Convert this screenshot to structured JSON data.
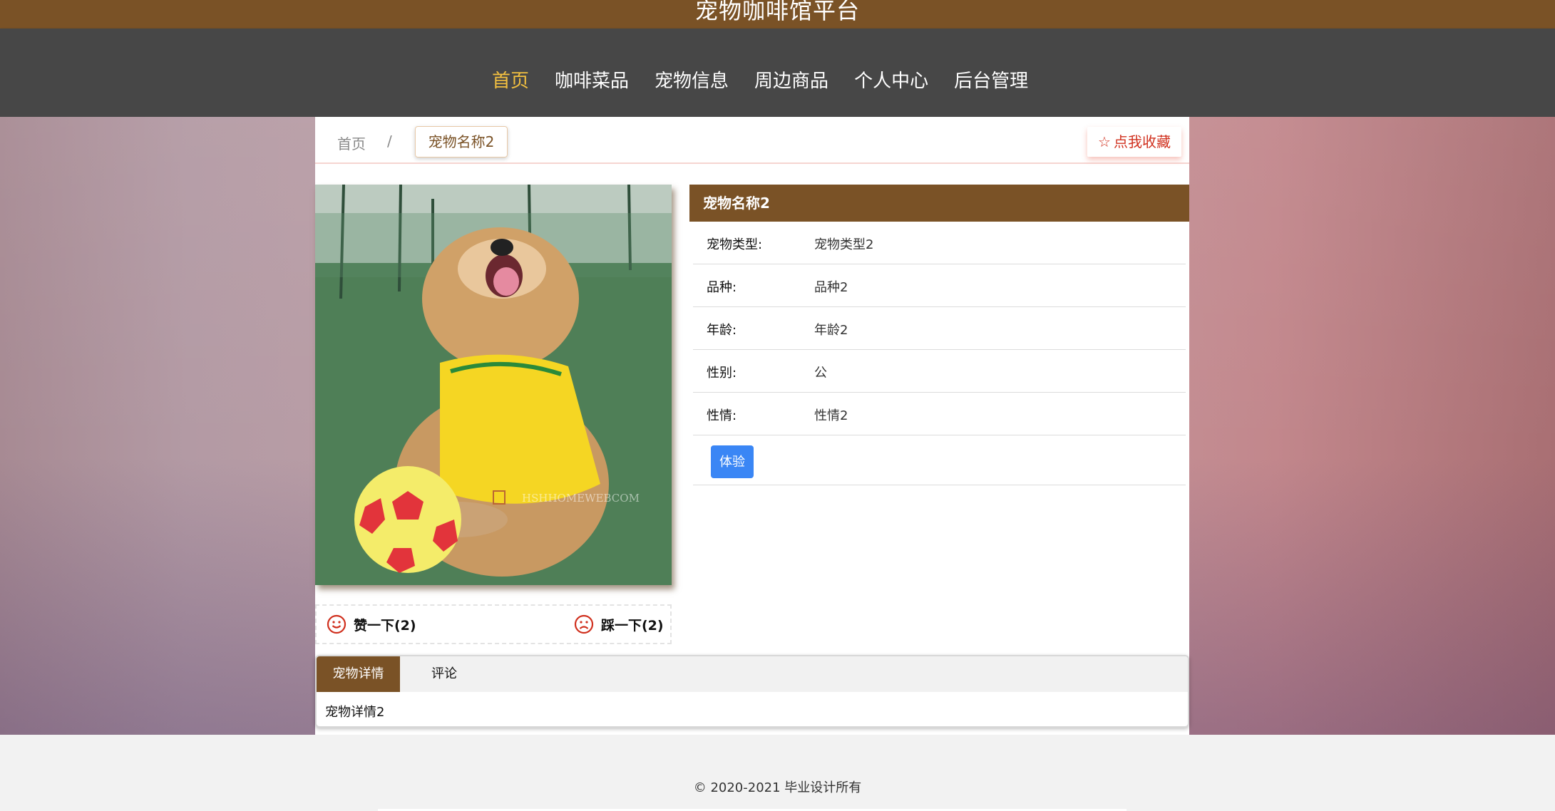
{
  "header": {
    "title": "宠物咖啡馆平台"
  },
  "nav": {
    "items": [
      {
        "label": "首页",
        "active": true
      },
      {
        "label": "咖啡菜品",
        "active": false
      },
      {
        "label": "宠物信息",
        "active": false
      },
      {
        "label": "周边商品",
        "active": false
      },
      {
        "label": "个人中心",
        "active": false
      },
      {
        "label": "后台管理",
        "active": false
      }
    ]
  },
  "breadcrumb": {
    "home": "首页",
    "separator": "/",
    "current": "宠物名称2"
  },
  "favorite": {
    "icon": "star-outline-icon",
    "label": "点我收藏"
  },
  "pet": {
    "name": "宠物名称2",
    "fields": [
      {
        "label": "宠物类型:",
        "value": "宠物类型2"
      },
      {
        "label": "品种:",
        "value": "品种2"
      },
      {
        "label": "年龄:",
        "value": "年龄2"
      },
      {
        "label": "性别:",
        "value": "公"
      },
      {
        "label": "性情:",
        "value": "性情2"
      }
    ],
    "action_label": "体验"
  },
  "votes": {
    "like_label": "赞一下(2)",
    "dislike_label": "踩一下(2)",
    "like_icon": "smile-icon",
    "dislike_icon": "frown-icon"
  },
  "tabs": {
    "items": [
      {
        "label": "宠物详情",
        "active": true
      },
      {
        "label": "评论",
        "active": false
      }
    ],
    "content": "宠物详情2"
  },
  "footer": {
    "copyright": "© 2020-2021 毕业设计所有"
  },
  "colors": {
    "brand": "#7a5226",
    "nav_bg": "#474747",
    "active_nav": "#f3c040",
    "button": "#3a86f5",
    "favorite": "#d0301e"
  }
}
